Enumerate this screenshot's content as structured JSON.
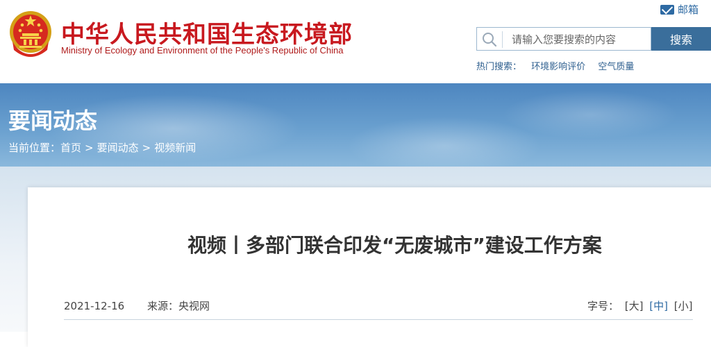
{
  "header": {
    "title": "中华人民共和国生态环境部",
    "subtitle": "Ministry of Ecology and Environment of the People's Republic of China",
    "mail_label": "邮箱"
  },
  "search": {
    "placeholder": "请输入您要搜索的内容",
    "button_label": "搜索",
    "hot_label": "热门搜索：",
    "hot_items": [
      "环境影响评价",
      "空气质量"
    ]
  },
  "banner": {
    "section_title": "要闻动态",
    "breadcrumb": {
      "prefix": "当前位置：",
      "items": [
        "首页",
        "要闻动态",
        "视频新闻"
      ],
      "separator": ">"
    }
  },
  "article": {
    "title": "视频丨多部门联合印发“无废城市”建设工作方案",
    "date": "2021-12-16",
    "source": "来源：央视网",
    "font_size": {
      "label": "字号：",
      "options": [
        "[大]",
        "[中]",
        "[小]"
      ],
      "active": "[中]"
    }
  },
  "colors": {
    "brand_red": "#c8191f",
    "accent_blue": "#3a6e9b",
    "link_blue": "#2e6aa3"
  }
}
